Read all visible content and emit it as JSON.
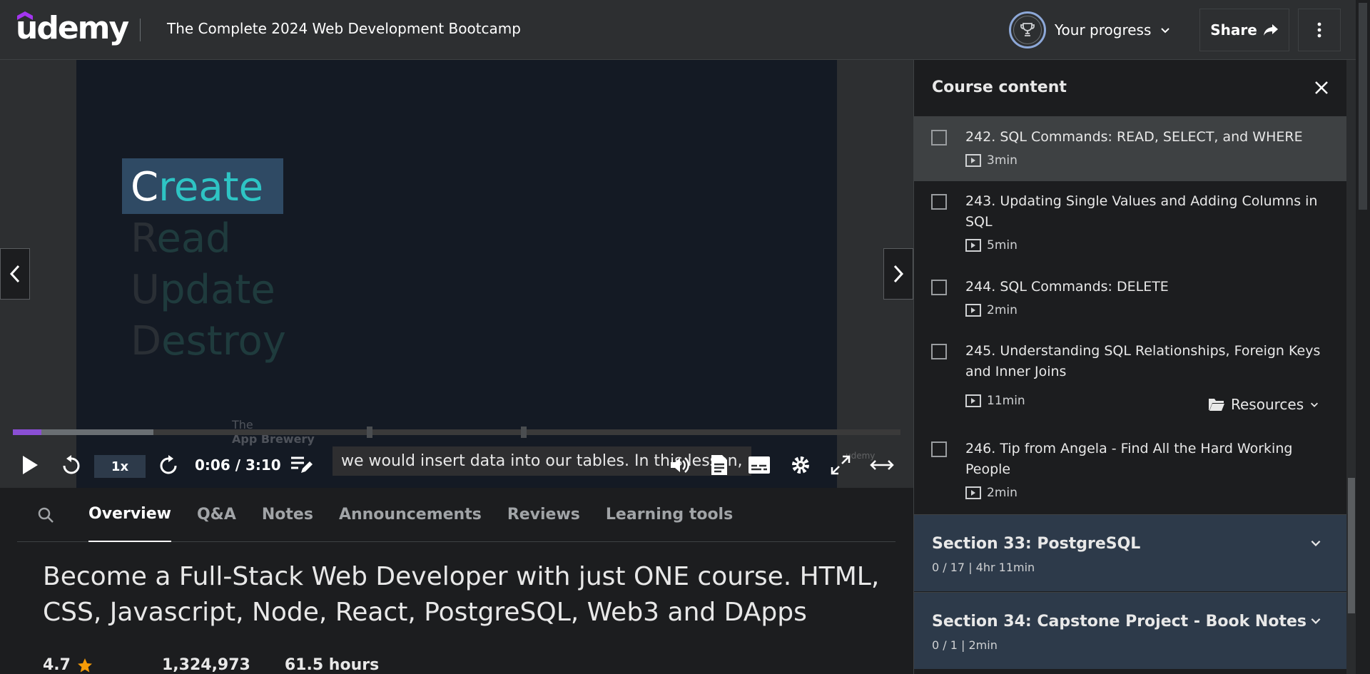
{
  "brand": {
    "logo_text": "udemy"
  },
  "header": {
    "course_title": "The Complete 2024 Web Development Bootcamp",
    "progress_label": "Your progress",
    "share_label": "Share"
  },
  "video": {
    "crud": {
      "create_first": "C",
      "create_rest": "reate",
      "read_first": "R",
      "read_rest": "ead",
      "update_first": "U",
      "update_rest": "pdate",
      "destroy_first": "D",
      "destroy_rest": "estroy"
    },
    "caption": "we would insert data into our tables. In this lesson,",
    "watermark_line1": "The",
    "watermark_line2": "App Brewery",
    "watermark_small": "udemy",
    "progress_fraction": 0.032,
    "buffered_fraction": 0.158
  },
  "controls": {
    "speed": "1x",
    "time": "0:06 / 3:10"
  },
  "tabs": [
    {
      "label": "Overview",
      "active": true
    },
    {
      "label": "Q&A"
    },
    {
      "label": "Notes"
    },
    {
      "label": "Announcements"
    },
    {
      "label": "Reviews"
    },
    {
      "label": "Learning tools"
    }
  ],
  "overview": {
    "headline": "Become a Full-Stack Web Developer with just ONE course. HTML, CSS, Javascript, Node, React, PostgreSQL, Web3 and DApps",
    "rating": "4.7",
    "students": "1,324,973",
    "hours": "61.5 hours"
  },
  "panel": {
    "title": "Course content",
    "lectures": [
      {
        "title": "242. SQL Commands: READ, SELECT, and WHERE",
        "duration": "3min",
        "active": true
      },
      {
        "title": "243. Updating Single Values and Adding Columns in SQL",
        "duration": "5min"
      },
      {
        "title": "244. SQL Commands: DELETE",
        "duration": "2min"
      },
      {
        "title": "245. Understanding SQL Relationships, Foreign Keys and Inner Joins",
        "duration": "11min",
        "resources": "Resources"
      },
      {
        "title": "246. Tip from Angela - Find All the Hard Working People",
        "duration": "2min"
      }
    ],
    "sections": [
      {
        "title": "Section 33: PostgreSQL",
        "meta": "0 / 17 | 4hr 11min"
      },
      {
        "title": "Section 34: Capstone Project - Book Notes",
        "meta": "0 / 1 | 2min"
      }
    ]
  },
  "colors": {
    "accent": "#8a4fd4",
    "teal": "#2ec4c4",
    "section_bg": "#2d3a4a"
  }
}
